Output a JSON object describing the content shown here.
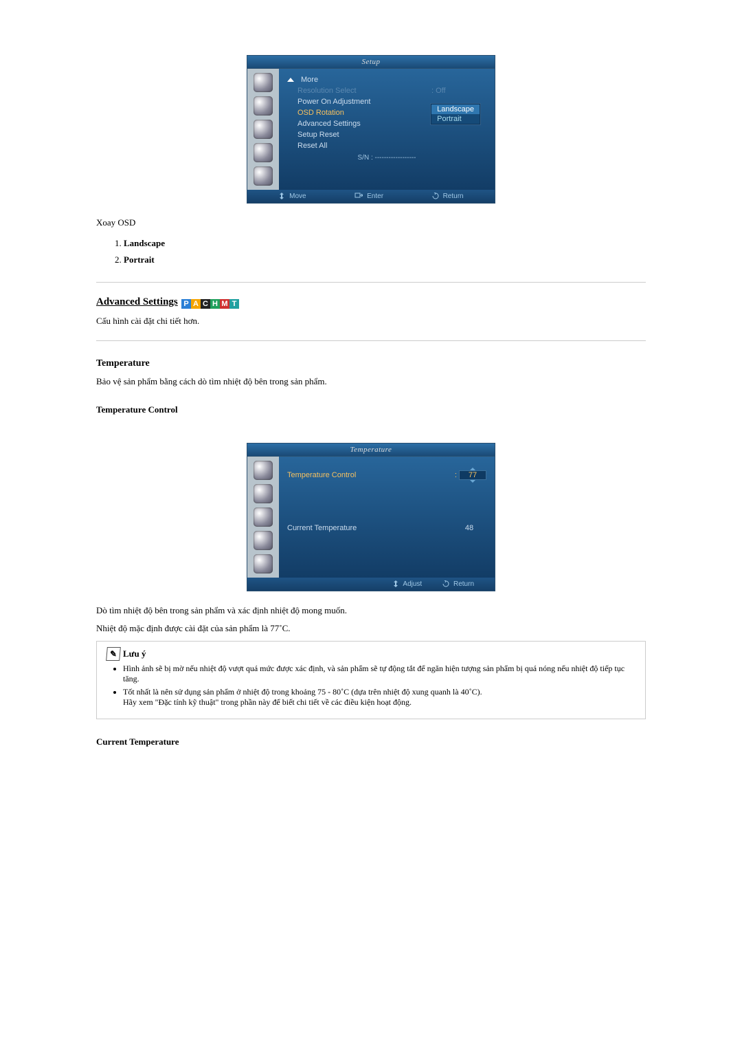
{
  "osd1": {
    "title": "Setup",
    "items": {
      "more": "More",
      "resSelect": "Resolution Select",
      "resVal": ": Off",
      "powerOn": "Power On Adjustment",
      "osdRotation": "OSD Rotation",
      "advSettings": "Advanced Settings",
      "setupReset": "Setup Reset",
      "resetAll": "Reset All"
    },
    "submenu": {
      "landscape": "Landscape",
      "portrait": "Portrait"
    },
    "sn": "S/N : ------------------",
    "footer": {
      "move": "Move",
      "enter": "Enter",
      "return": "Return"
    }
  },
  "textTop": "Xoay OSD",
  "list": {
    "landscape": "Landscape",
    "portrait": "Portrait"
  },
  "advHeading": "Advanced Settings",
  "advDesc": "Cấu hình cài đặt chi tiết hơn.",
  "tempHeading": "Temperature",
  "tempDesc": "Bảo vệ sản phẩm bằng cách dò tìm nhiệt độ bên trong sản phẩm.",
  "tempControlHeading": "Temperature Control",
  "osd2": {
    "title": "Temperature",
    "tempCtrl": "Temperature Control",
    "tempCtrlVal": "77",
    "curTemp": "Current Temperature",
    "curTempVal": "48",
    "footer": {
      "adjust": "Adjust",
      "return": "Return"
    }
  },
  "afterOsd2_1": "Dò tìm nhiệt độ bên trong sản phẩm và xác định nhiệt độ mong muốn.",
  "afterOsd2_2": "Nhiệt độ mặc định được cài đặt của sản phẩm là 77˚C.",
  "note": {
    "title": "Lưu ý",
    "b1": "Hình ảnh sẽ bị mờ nếu nhiệt độ vượt quá mức được xác định, và sản phẩm sẽ tự động tắt để ngăn hiện tượng sản phẩm bị quá nóng nếu nhiệt độ tiếp tục tăng.",
    "b2a": "Tốt nhất là nên sử dụng sản phẩm ở nhiệt độ trong khoảng 75 - 80˚C (dựa trên nhiệt độ xung quanh là 40˚C).",
    "b2b": "Hãy xem \"Đặc tính kỹ thuật\" trong phần này để biết chi tiết về các điều kiện hoạt động."
  },
  "curTempHeading": "Current Temperature"
}
